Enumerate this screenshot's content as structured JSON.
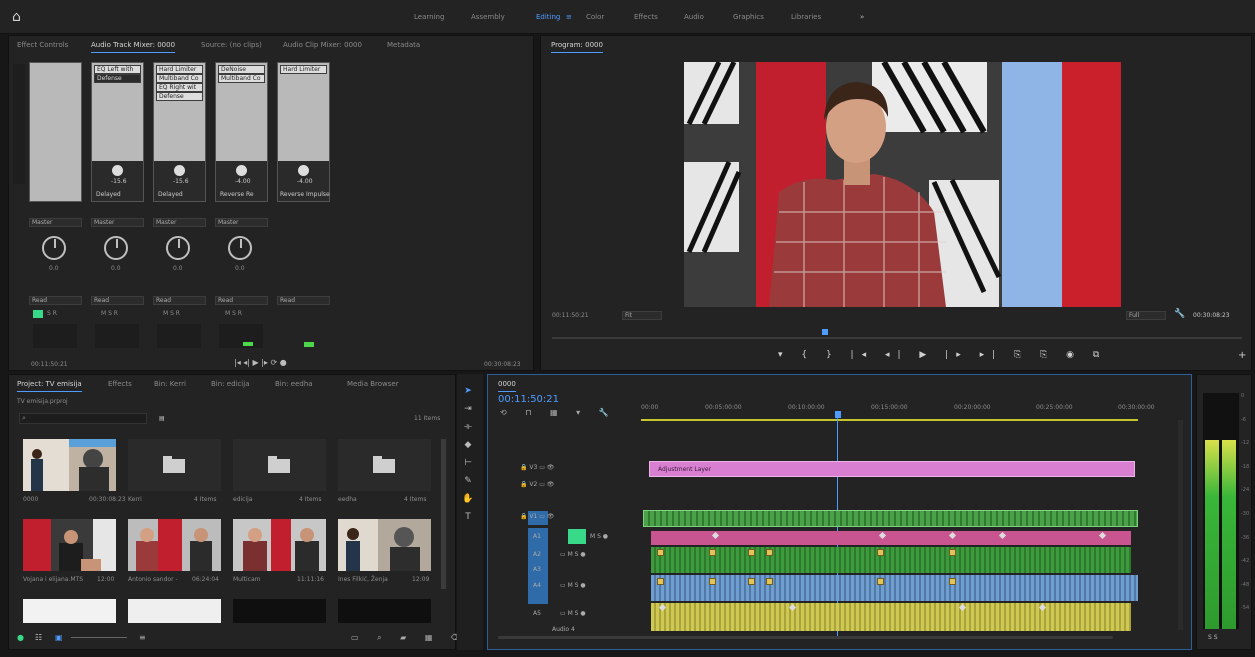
{
  "workspaces": [
    "Learning",
    "Assembly",
    "Editing",
    "Color",
    "Effects",
    "Audio",
    "Graphics",
    "Libraries"
  ],
  "active_workspace": "Editing",
  "source_panel": {
    "tabs": [
      "Effect Controls",
      "Audio Track Mixer: 0000",
      "Source: (no clips)",
      "Audio Clip Mixer: 0000",
      "Metadata"
    ],
    "active_tab": "Audio Track Mixer: 0000",
    "effects": [
      [
        "EQ Left with",
        "Defense"
      ],
      [
        "Hard Limiter",
        "Multiband Co",
        "EQ Right wit",
        "Defense"
      ],
      [
        "DeNoise",
        "Multiband Co"
      ],
      [
        "Hard Limiter"
      ]
    ],
    "send_values": [
      "-15.6",
      "-15.6",
      "-4.00",
      "-4.00"
    ],
    "send_labels": [
      "Delayed",
      "Delayed",
      "Reverse Re",
      "Reverse Impulse"
    ],
    "output": [
      "Master",
      "Master",
      "Master",
      "Master"
    ],
    "pan_values": [
      "0.0",
      "0.0",
      "0.0",
      "0.0"
    ],
    "automation": [
      "Read",
      "Read",
      "Read",
      "Read",
      "Read"
    ],
    "timecode_left": "00:11:50:21",
    "timecode_right": "00:30:08:23"
  },
  "program": {
    "title": "Program: 0000",
    "timecode": "00:11:50:21",
    "fit": "Fit",
    "quality": "Full",
    "duration": "00:30:08:23"
  },
  "project": {
    "tabs": [
      "Project: TV emisija",
      "Effects",
      "Bin: Kerri",
      "Bin: edicija",
      "Bin: eedha",
      "Media Browser"
    ],
    "active_tab": "Project: TV emisija",
    "path": "TV emisija.prproj",
    "search_placeholder": "",
    "items_count": "11 Items",
    "row1": [
      {
        "name": "0000",
        "meta": "00:30:08:23"
      },
      {
        "name": "Kerri",
        "meta": "4 Items"
      },
      {
        "name": "edicija",
        "meta": "4 Items"
      },
      {
        "name": "eedha",
        "meta": "4 Items"
      }
    ],
    "row2": [
      {
        "name": "Vojana i elijana.MTS",
        "meta": "12:00"
      },
      {
        "name": "Antonio sandor -",
        "meta": "06:24:04"
      },
      {
        "name": "Multicam",
        "meta": "11:11:16"
      },
      {
        "name": "Ines Filkić, Ženja",
        "meta": "12:09"
      }
    ]
  },
  "timeline": {
    "sequence": "0000",
    "timecode": "00:11:50:21",
    "ruler": [
      "00:00",
      "00:05:00:00",
      "00:10:00:00",
      "00:15:00:00",
      "00:20:00:00",
      "00:25:00:00",
      "00:30:00:00"
    ],
    "adjustment_label": "Adjustment Layer",
    "video_tracks": [
      "V3",
      "V2",
      "V1"
    ],
    "audio_tracks": [
      "A1",
      "A2",
      "A3",
      "A4",
      "A5"
    ],
    "mix_label": "Audio 4"
  },
  "meter": {
    "level_left": 0.8,
    "level_right": 0.8,
    "scale": [
      "0",
      "-6",
      "-12",
      "-18",
      "-24",
      "-30",
      "-36",
      "-42",
      "-48",
      "-54"
    ]
  },
  "colors": {
    "accent": "#4f9cff",
    "adjustment": "#d97fd2",
    "video": "#3fb73f",
    "audio_pink": "#c8558f",
    "audio_green": "#3c9b3c",
    "audio_blue": "#5f8fbf",
    "audio_yellow": "#c8c24a"
  }
}
